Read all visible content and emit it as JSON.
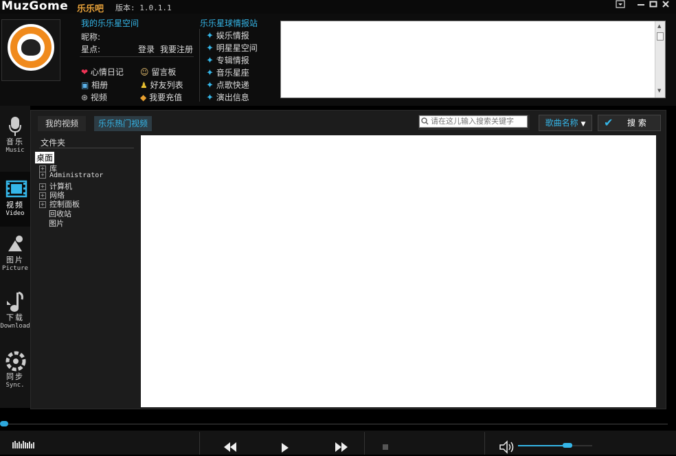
{
  "app": {
    "logo": "MuzGome",
    "logo_cn": "乐乐吧",
    "version": "版本: 1.0.1.1"
  },
  "window": {
    "menu_icon": "menu-icon",
    "minimize_icon": "minimize-icon",
    "maximize_icon": "maximize-icon",
    "close_icon": "close-icon"
  },
  "profile": {
    "section_title": "我的乐乐星空间",
    "nickname_label": "昵称:",
    "points_label": "星点:",
    "login": "登录",
    "register": "我要注册",
    "links": [
      {
        "label": "心情日记",
        "icon": "mood-diary-icon"
      },
      {
        "label": "留言板",
        "icon": "message-board-icon"
      },
      {
        "label": "相册",
        "icon": "album-icon"
      },
      {
        "label": "好友列表",
        "icon": "friends-icon"
      },
      {
        "label": "视频",
        "icon": "video-icon"
      },
      {
        "label": "我要充值",
        "icon": "recharge-icon"
      }
    ]
  },
  "news": {
    "section_title": "乐乐星球情报站",
    "items": [
      "娱乐情报",
      "明星星空间",
      "专辑情报",
      "音乐星座",
      "点歌快递",
      "演出信息"
    ]
  },
  "nav": [
    {
      "label": "音乐",
      "sub": "Music",
      "icon": "microphone-icon"
    },
    {
      "label": "视频",
      "sub": "Video",
      "icon": "film-icon"
    },
    {
      "label": "图片",
      "sub": "Picture",
      "icon": "picture-icon"
    },
    {
      "label": "下载",
      "sub": "Download",
      "icon": "download-icon"
    },
    {
      "label": "同步",
      "sub": "Sync.",
      "icon": "sync-icon"
    }
  ],
  "tabs": [
    "我的视频",
    "乐乐热门视频"
  ],
  "search": {
    "placeholder": "请在这儿输入搜索关键字",
    "dropdown_value": "歌曲名称",
    "button": "搜 索"
  },
  "folder": {
    "title": "文件夹",
    "selected": "桌面",
    "items": [
      {
        "label": "库",
        "expandable": true
      },
      {
        "label": "Administrator",
        "expandable": true
      },
      {
        "label": "计算机",
        "expandable": true
      },
      {
        "label": "网络",
        "expandable": true
      },
      {
        "label": "控制面板",
        "expandable": true
      },
      {
        "label": "回收站",
        "expandable": false
      },
      {
        "label": "图片",
        "expandable": false
      }
    ]
  },
  "player": {
    "volume": 0.67,
    "progress": 0.0
  }
}
